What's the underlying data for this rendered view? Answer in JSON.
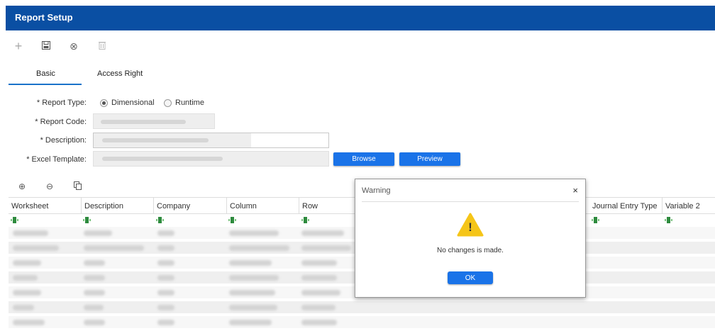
{
  "window": {
    "title": "Report Setup"
  },
  "toolbar": {
    "add_icon": "+",
    "save_icon": "💾",
    "cancel_icon": "⊗",
    "delete_icon": "🗑"
  },
  "tabs": [
    {
      "label": "Basic",
      "active": true
    },
    {
      "label": "Access Right",
      "active": false
    }
  ],
  "form": {
    "report_type_label": "* Report Type:",
    "report_type_options": [
      "Dimensional",
      "Runtime"
    ],
    "report_type_selected": "Dimensional",
    "report_code_label": "* Report Code:",
    "description_label": "* Description:",
    "excel_template_label": "* Excel Template:",
    "browse_label": "Browse",
    "preview_label": "Preview"
  },
  "grid": {
    "add_icon": "⊕",
    "remove_icon": "⊖",
    "copy_icon": "⎘",
    "columns": [
      "Worksheet",
      "Description",
      "Company",
      "Column",
      "Row",
      "Journal Entry Type",
      "Variable 2"
    ]
  },
  "dialog": {
    "title": "Warning",
    "close_icon": "×",
    "message": "No changes is made.",
    "ok_label": "OK",
    "warning_icon": "!"
  },
  "colors": {
    "title_bar": "#0a4fa3",
    "accent": "#1a73e8",
    "warning": "#f5c518",
    "excel_green": "#2e8b3e"
  }
}
